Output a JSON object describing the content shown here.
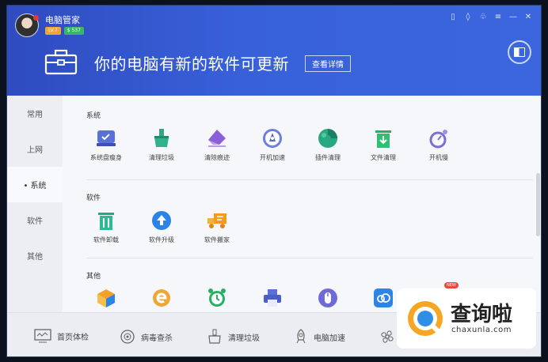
{
  "app": {
    "name": "电脑管家",
    "level_badge": "LV.7",
    "coin_badge": "$ 537"
  },
  "window_controls": [
    "▯",
    "◊",
    "♧",
    "≡",
    "—",
    "✕"
  ],
  "banner": {
    "headline": "你的电脑有新的软件可更新",
    "detail_button": "查看详情"
  },
  "sidebar": {
    "items": [
      {
        "label": "常用"
      },
      {
        "label": "上网"
      },
      {
        "label": "• 系统"
      },
      {
        "label": "软件"
      },
      {
        "label": "其他"
      }
    ]
  },
  "sections": {
    "system": {
      "title": "系统",
      "tools": [
        {
          "label": "系统盘瘦身",
          "icon": "disk-slim-icon"
        },
        {
          "label": "清理垃圾",
          "icon": "broom-icon"
        },
        {
          "label": "清除痕迹",
          "icon": "eraser-icon"
        },
        {
          "label": "开机加速",
          "icon": "rocket-icon"
        },
        {
          "label": "插件清理",
          "icon": "puzzle-icon"
        },
        {
          "label": "文件清理",
          "icon": "trash-file-icon"
        },
        {
          "label": "开机慢",
          "icon": "stopwatch-icon"
        }
      ]
    },
    "software": {
      "title": "软件",
      "tools": [
        {
          "label": "软件卸载",
          "icon": "uninstall-icon"
        },
        {
          "label": "软件升级",
          "icon": "upgrade-icon"
        },
        {
          "label": "软件搬家",
          "icon": "move-truck-icon"
        }
      ]
    },
    "other": {
      "title": "其他",
      "new_tag": "NEW"
    }
  },
  "bottom_bar": {
    "items": [
      {
        "label": "首页体检",
        "icon": "monitor-check-icon"
      },
      {
        "label": "病毒查杀",
        "icon": "virus-scan-icon"
      },
      {
        "label": "清理垃圾",
        "icon": "broom-icon"
      },
      {
        "label": "电脑加速",
        "icon": "rocket-icon"
      },
      {
        "label": "乡",
        "icon": "fan-icon"
      }
    ]
  },
  "watermark": {
    "text": "查询啦",
    "url": "chaxunla.com"
  },
  "colors": {
    "header_blue": "#3861d9",
    "accent_blue": "#2d84e8"
  }
}
